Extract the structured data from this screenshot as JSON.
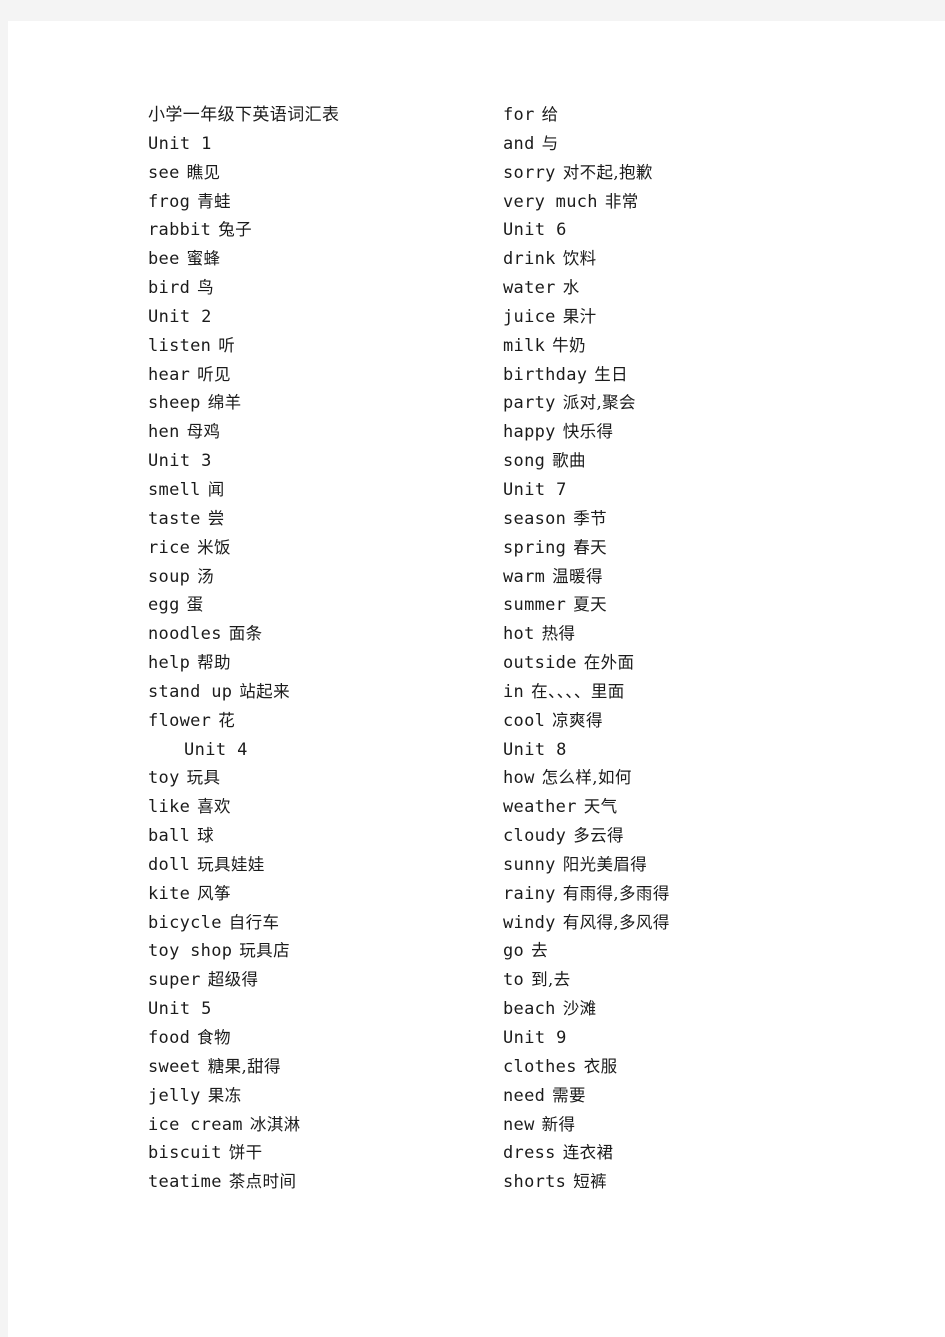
{
  "document": {
    "title": "小学一年级下英语词汇表",
    "page_background": "#ffffff",
    "canvas_background": "#f4f4f4",
    "text_color": "#1b1b1b"
  },
  "columns": [
    {
      "name": "left-column",
      "lines": [
        {
          "kind": "title",
          "en": "",
          "zh": "小学一年级下英语词汇表",
          "indented": false
        },
        {
          "kind": "unit",
          "en": "Unit 1",
          "zh": "",
          "indented": false
        },
        {
          "kind": "entry",
          "en": "see",
          "zh": "瞧见",
          "indented": false
        },
        {
          "kind": "entry",
          "en": "frog",
          "zh": "青蛙",
          "indented": false
        },
        {
          "kind": "entry",
          "en": "rabbit",
          "zh": "兔子",
          "indented": false
        },
        {
          "kind": "entry",
          "en": "bee",
          "zh": "蜜蜂",
          "indented": false
        },
        {
          "kind": "entry",
          "en": "bird",
          "zh": "鸟",
          "indented": false
        },
        {
          "kind": "unit",
          "en": "Unit 2",
          "zh": "",
          "indented": false
        },
        {
          "kind": "entry",
          "en": "listen",
          "zh": "听",
          "indented": false
        },
        {
          "kind": "entry",
          "en": "hear",
          "zh": "听见",
          "indented": false
        },
        {
          "kind": "entry",
          "en": "sheep",
          "zh": "绵羊",
          "indented": false
        },
        {
          "kind": "entry",
          "en": "hen",
          "zh": "母鸡",
          "indented": false
        },
        {
          "kind": "unit",
          "en": "Unit 3",
          "zh": "",
          "indented": false
        },
        {
          "kind": "entry",
          "en": "smell",
          "zh": "闻",
          "indented": false
        },
        {
          "kind": "entry",
          "en": "taste",
          "zh": "尝",
          "indented": false
        },
        {
          "kind": "entry",
          "en": "rice",
          "zh": "米饭",
          "indented": false
        },
        {
          "kind": "entry",
          "en": "soup",
          "zh": "汤",
          "indented": false
        },
        {
          "kind": "entry",
          "en": "egg",
          "zh": "蛋",
          "indented": false
        },
        {
          "kind": "entry",
          "en": "noodles",
          "zh": "面条",
          "indented": false
        },
        {
          "kind": "entry",
          "en": "help",
          "zh": "帮助",
          "indented": false
        },
        {
          "kind": "entry",
          "en": "stand up",
          "zh": "站起来",
          "indented": false
        },
        {
          "kind": "entry",
          "en": "flower",
          "zh": "花",
          "indented": false
        },
        {
          "kind": "unit",
          "en": "Unit 4",
          "zh": "",
          "indented": true
        },
        {
          "kind": "entry",
          "en": "toy",
          "zh": "玩具",
          "indented": false
        },
        {
          "kind": "entry",
          "en": "like",
          "zh": "喜欢",
          "indented": false
        },
        {
          "kind": "entry",
          "en": "ball",
          "zh": "球",
          "indented": false
        },
        {
          "kind": "entry",
          "en": "doll",
          "zh": "玩具娃娃",
          "indented": false
        },
        {
          "kind": "entry",
          "en": "kite",
          "zh": "风筝",
          "indented": false
        },
        {
          "kind": "entry",
          "en": "bicycle",
          "zh": "自行车",
          "indented": false
        },
        {
          "kind": "entry",
          "en": "toy shop",
          "zh": "玩具店",
          "indented": false
        },
        {
          "kind": "entry",
          "en": "super",
          "zh": "超级得",
          "indented": false
        },
        {
          "kind": "unit",
          "en": "Unit 5",
          "zh": "",
          "indented": false
        },
        {
          "kind": "entry",
          "en": "food",
          "zh": "食物",
          "indented": false
        },
        {
          "kind": "entry",
          "en": "sweet",
          "zh": "糖果,甜得",
          "indented": false
        },
        {
          "kind": "entry",
          "en": "jelly",
          "zh": "果冻",
          "indented": false
        },
        {
          "kind": "entry",
          "en": "ice cream",
          "zh": "冰淇淋",
          "indented": false
        },
        {
          "kind": "entry",
          "en": "biscuit",
          "zh": "饼干",
          "indented": false
        },
        {
          "kind": "entry",
          "en": "teatime",
          "zh": "茶点时间",
          "indented": false
        }
      ]
    },
    {
      "name": "right-column",
      "lines": [
        {
          "kind": "entry",
          "en": "for",
          "zh": "给",
          "indented": false
        },
        {
          "kind": "entry",
          "en": "and",
          "zh": "与",
          "indented": false
        },
        {
          "kind": "entry",
          "en": "sorry",
          "zh": "对不起,抱歉",
          "indented": false
        },
        {
          "kind": "entry",
          "en": "very much",
          "zh": "非常",
          "indented": false
        },
        {
          "kind": "unit",
          "en": "Unit 6",
          "zh": "",
          "indented": false
        },
        {
          "kind": "entry",
          "en": "drink",
          "zh": "饮料",
          "indented": false
        },
        {
          "kind": "entry",
          "en": "water",
          "zh": "水",
          "indented": false
        },
        {
          "kind": "entry",
          "en": "juice",
          "zh": "果汁",
          "indented": false
        },
        {
          "kind": "entry",
          "en": "milk",
          "zh": "牛奶",
          "indented": false
        },
        {
          "kind": "entry",
          "en": "birthday",
          "zh": "生日",
          "indented": false
        },
        {
          "kind": "entry",
          "en": "party",
          "zh": "派对,聚会",
          "indented": false
        },
        {
          "kind": "entry",
          "en": "happy",
          "zh": "快乐得",
          "indented": false
        },
        {
          "kind": "entry",
          "en": "song",
          "zh": "歌曲",
          "indented": false
        },
        {
          "kind": "unit",
          "en": "Unit 7",
          "zh": "",
          "indented": false
        },
        {
          "kind": "entry",
          "en": "season",
          "zh": "季节",
          "indented": false
        },
        {
          "kind": "entry",
          "en": "spring",
          "zh": "春天",
          "indented": false
        },
        {
          "kind": "entry",
          "en": "warm",
          "zh": "温暖得",
          "indented": false
        },
        {
          "kind": "entry",
          "en": "summer",
          "zh": "夏天",
          "indented": false
        },
        {
          "kind": "entry",
          "en": "hot",
          "zh": "热得",
          "indented": false
        },
        {
          "kind": "entry",
          "en": "outside",
          "zh": "在外面",
          "indented": false
        },
        {
          "kind": "entry",
          "en": "in",
          "zh": "在、、、、里面",
          "indented": false
        },
        {
          "kind": "entry",
          "en": "cool",
          "zh": "凉爽得",
          "indented": false
        },
        {
          "kind": "unit",
          "en": "Unit 8",
          "zh": "",
          "indented": false
        },
        {
          "kind": "entry",
          "en": "how",
          "zh": "怎么样,如何",
          "indented": false
        },
        {
          "kind": "entry",
          "en": "weather",
          "zh": "天气",
          "indented": false
        },
        {
          "kind": "entry",
          "en": "cloudy",
          "zh": "多云得",
          "indented": false
        },
        {
          "kind": "entry",
          "en": "sunny",
          "zh": "阳光美眉得",
          "indented": false
        },
        {
          "kind": "entry",
          "en": "rainy",
          "zh": "有雨得,多雨得",
          "indented": false
        },
        {
          "kind": "entry",
          "en": "windy",
          "zh": "有风得,多风得",
          "indented": false
        },
        {
          "kind": "entry",
          "en": "go",
          "zh": "去",
          "indented": false
        },
        {
          "kind": "entry",
          "en": "to",
          "zh": "到,去",
          "indented": false
        },
        {
          "kind": "entry",
          "en": "beach",
          "zh": "沙滩",
          "indented": false
        },
        {
          "kind": "unit",
          "en": "Unit 9",
          "zh": "",
          "indented": false
        },
        {
          "kind": "entry",
          "en": "clothes",
          "zh": "衣服",
          "indented": false
        },
        {
          "kind": "entry",
          "en": "need",
          "zh": "需要",
          "indented": false
        },
        {
          "kind": "entry",
          "en": "new",
          "zh": "新得",
          "indented": false
        },
        {
          "kind": "entry",
          "en": "dress",
          "zh": "连衣裙",
          "indented": false
        },
        {
          "kind": "entry",
          "en": "shorts",
          "zh": "短裤",
          "indented": false
        }
      ]
    }
  ]
}
